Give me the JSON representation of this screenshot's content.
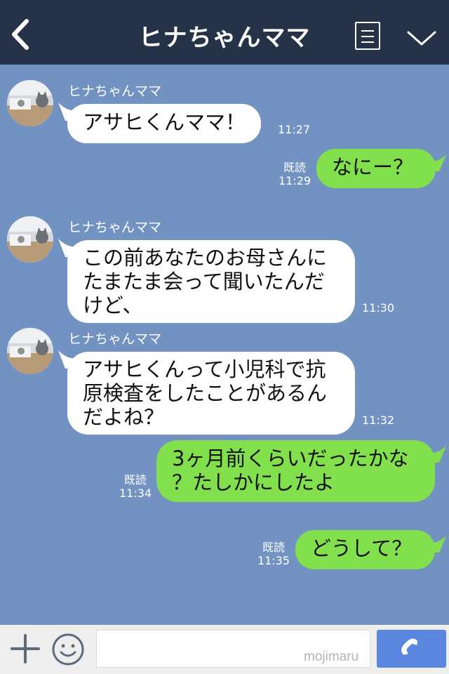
{
  "header": {
    "title": "ヒナちゃんママ",
    "icons": {
      "back": "back-icon",
      "menu": "list-menu-icon",
      "more": "chevron-down-icon"
    }
  },
  "colors": {
    "header_bg": "#253248",
    "chat_bg": "#7293c1",
    "incoming_bubble": "#ffffff",
    "outgoing_bubble": "#82e04d",
    "call_button": "#5a86df"
  },
  "messages": [
    {
      "direction": "incoming",
      "sender": "ヒナちゃんママ",
      "text": "アサヒくんママ！",
      "time": "11:27"
    },
    {
      "direction": "outgoing",
      "text": "なにー？",
      "read": "既読",
      "time": "11:29"
    },
    {
      "direction": "incoming",
      "sender": "ヒナちゃんママ",
      "lines": [
        "この前あなたのお母さんに",
        "たまたま会って聞いたんだ",
        "けど、"
      ],
      "time": "11:30"
    },
    {
      "direction": "incoming",
      "sender": "ヒナちゃんママ",
      "lines": [
        "アサヒくんって小児科で抗",
        "原検査をしたことがあるん",
        "だよね？"
      ],
      "time": "11:32"
    },
    {
      "direction": "outgoing",
      "lines": [
        "3ヶ月前くらいだったかな",
        "？たしかにしたよ"
      ],
      "read": "既読",
      "time": "11:34"
    },
    {
      "direction": "outgoing",
      "text": "どうして？",
      "read": "既読",
      "time": "11:35"
    }
  ],
  "footer": {
    "icons": {
      "add": "plus-icon",
      "emoji": "smiley-icon",
      "call": "phone-icon"
    },
    "input_value": "",
    "watermark": "mojimaru"
  }
}
